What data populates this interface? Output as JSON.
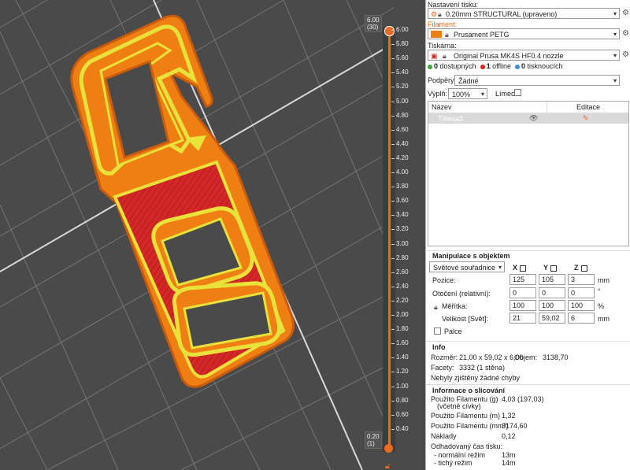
{
  "colors": {
    "accent": "#ed6b21",
    "filament": "#f07f13",
    "infill": "#e8e23a",
    "support": "#d42727",
    "green": "#3aa83a",
    "red": "#e02020",
    "blue": "#3a8ee0"
  },
  "slider": {
    "top_value": "6.00",
    "top_layer": "(30)",
    "bottom_value": "0.20",
    "bottom_layer": "(1)",
    "ticks": [
      "6.00",
      "5.80",
      "5.60",
      "5.40",
      "5.20",
      "5.00",
      "4.80",
      "4.60",
      "4.40",
      "4.20",
      "4.00",
      "3.80",
      "3.60",
      "3.40",
      "3.20",
      "3.00",
      "2.80",
      "2.60",
      "2.40",
      "2.20",
      "2.00",
      "1.80",
      "1.60",
      "1.40",
      "1.20",
      "1.00",
      "0.80",
      "0.60",
      "0.40"
    ]
  },
  "settings": {
    "print_label": "Nastavení tisku:",
    "print_value": "0.20mm STRUCTURAL (upraveno)",
    "filament_label": "Filament:",
    "filament_value": "Prusament PETG",
    "printer_label": "Tiskárna:",
    "printer_value": "Original Prusa MK4S HF0.4 nozzle",
    "status_available_count": "0",
    "status_available": "dostupných",
    "status_offline_count": "1",
    "status_offline": "offline",
    "status_printing_count": "0",
    "status_printing": "tisknoucích",
    "supports_label": "Podpěry:",
    "supports_value": "Žádné",
    "infill_label": "Výplň:",
    "infill_value": "100%",
    "brim_label": "Límec:"
  },
  "object_list": {
    "col_name": "Název",
    "col_edit": "Editace",
    "row_name": "Tělesa3"
  },
  "manipulation": {
    "title": "Manipulace s objektem",
    "coords": "Světové souřadnice",
    "x": "X",
    "y": "Y",
    "z": "Z",
    "position_label": "Pozice:",
    "position": [
      "125",
      "105",
      "3"
    ],
    "position_unit": "mm",
    "rotation_label": "Otočení (relativní):",
    "rotation": [
      "0",
      "0",
      "0"
    ],
    "rotation_unit": "°",
    "scale_label": "Měřítka:",
    "scale": [
      "100",
      "100",
      "100"
    ],
    "scale_unit": "%",
    "size_label": "Velikost [Svět]:",
    "size": [
      "21",
      "59,02",
      "6"
    ],
    "size_unit": "mm",
    "inches_label": "Palce"
  },
  "info": {
    "title": "Info",
    "size_label": "Rozměr:",
    "size_value": "21,00 x 59,02 x 6,00",
    "volume_label": "Objem:",
    "volume_value": "3138,70",
    "facets_label": "Facety:",
    "facets_value": "3332 (1 stěna)",
    "errors": "Nebyly zjištěny žádné chyby"
  },
  "slicing": {
    "title": "Informace o slicování",
    "fil_g_label": "Použito Filamentu (g)",
    "fil_g_sub": "(včetně cívky)",
    "fil_g_value": "4,03 (197,03)",
    "fil_m_label": "Použito Filamentu (m)",
    "fil_m_value": "1,32",
    "fil_mm3_label": "Použito Filamentu (mm³)",
    "fil_mm3_value": "3174,60",
    "cost_label": "Náklady",
    "cost_value": "0,12",
    "time_label": "Odhadovaný čas tisku:",
    "normal_label": "- normální režim",
    "normal_value": "13m",
    "silent_label": "- tichý režim",
    "silent_value": "14m"
  }
}
